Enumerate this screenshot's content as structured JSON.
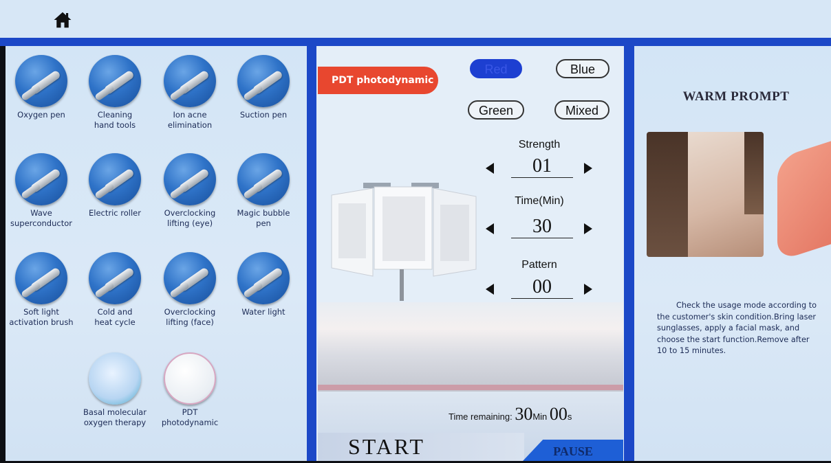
{
  "header": {
    "home_icon": "home-icon"
  },
  "tools": [
    {
      "label": "Oxygen pen"
    },
    {
      "label": "Cleaning\nhand tools"
    },
    {
      "label": "Ion acne\nelimination"
    },
    {
      "label": "Suction pen"
    },
    {
      "label": "Wave\nsuperconductor"
    },
    {
      "label": "Electric roller"
    },
    {
      "label": "Overclocking\nlifting (eye)"
    },
    {
      "label": "Magic bubble\npen"
    },
    {
      "label": "Soft light\nactivation brush"
    },
    {
      "label": "Cold and\nheat cycle"
    },
    {
      "label": "Overclocking\nlifting (face)"
    },
    {
      "label": "Water light"
    },
    {
      "label": "Basal molecular\noxygen therapy"
    },
    {
      "label": "PDT\nphotodynamic"
    }
  ],
  "middle": {
    "mode_badge": "PDT photodynamic",
    "colors": [
      "Red",
      "Blue",
      "Green",
      "Mixed"
    ],
    "selected_color": "Red",
    "strength": {
      "label": "Strength",
      "value": "01"
    },
    "time": {
      "label": "Time(Min)",
      "value": "30"
    },
    "pattern": {
      "label": "Pattern",
      "value": "00"
    },
    "time_remaining_label": "Time remaining:",
    "time_remaining_min": "30",
    "min_unit": "Min",
    "time_remaining_sec": "00",
    "sec_unit": "s",
    "start_label": "START",
    "pause_label": "PAUSE"
  },
  "right": {
    "title": "WARM PROMPT",
    "text": "Check the usage mode according to the customer's skin condition.Bring laser sunglasses, apply a facial mask, and choose the start function.Remove after 10 to 15 minutes."
  },
  "colors": {
    "accent": "#1c48c7",
    "badge": "#e8472f",
    "panel_bg": "#d7e7f6"
  }
}
